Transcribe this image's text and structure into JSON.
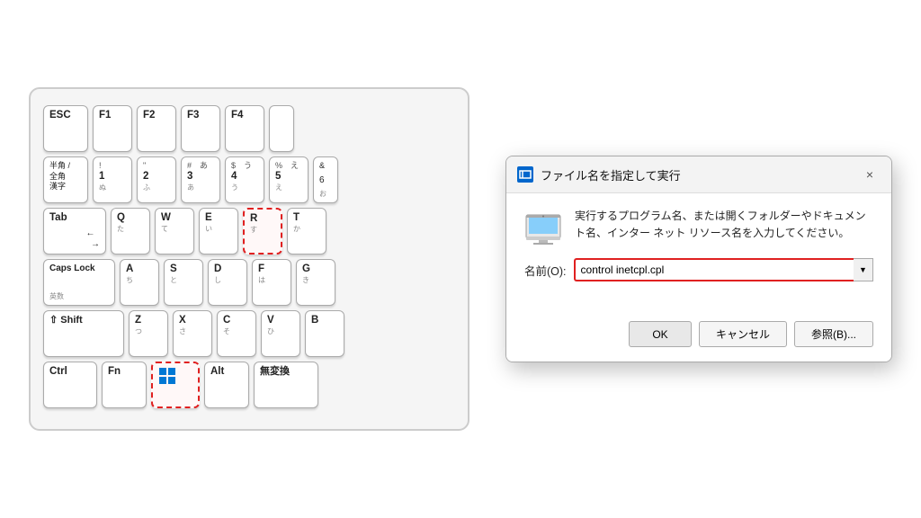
{
  "keyboard": {
    "rows": [
      {
        "id": "row0",
        "keys": [
          {
            "id": "esc",
            "label": "ESC",
            "sub": "",
            "jp": "",
            "wide": "esc",
            "highlighted": false
          },
          {
            "id": "f1",
            "label": "F1",
            "sub": "",
            "jp": "",
            "wide": "",
            "highlighted": false
          },
          {
            "id": "f2",
            "label": "F2",
            "sub": "",
            "jp": "",
            "wide": "",
            "highlighted": false
          },
          {
            "id": "f3",
            "label": "F3",
            "sub": "",
            "jp": "",
            "wide": "",
            "highlighted": false
          },
          {
            "id": "f4",
            "label": "F4",
            "sub": "",
            "jp": "",
            "wide": "",
            "highlighted": false
          },
          {
            "id": "f5-half",
            "label": "",
            "sub": "",
            "jp": "",
            "wide": "half-visible",
            "highlighted": false
          }
        ]
      },
      {
        "id": "row1",
        "keys": [
          {
            "id": "hankaku",
            "label": "半角 /\n全角\n漢字",
            "sub": "",
            "jp": "",
            "wide": "",
            "highlighted": false
          },
          {
            "id": "1",
            "label": "!",
            "sub": "1",
            "jp": "ぬ",
            "wide": "",
            "highlighted": false
          },
          {
            "id": "2",
            "label": "\"",
            "sub": "2",
            "jp": "ふ",
            "wide": "",
            "highlighted": false
          },
          {
            "id": "3",
            "label": "#",
            "sub": "3",
            "jp": "あ",
            "wide": "",
            "highlighted": false
          },
          {
            "id": "4",
            "label": "$",
            "sub": "4",
            "jp": "う",
            "wide": "",
            "highlighted": false
          },
          {
            "id": "5",
            "label": "%",
            "sub": "5",
            "jp": "え",
            "wide": "",
            "highlighted": false
          },
          {
            "id": "6",
            "label": "&",
            "sub": "6",
            "jp": "お",
            "wide": "half-visible",
            "highlighted": false
          }
        ]
      },
      {
        "id": "row2",
        "keys": [
          {
            "id": "tab",
            "label": "Tab",
            "sub": "←\n→",
            "jp": "",
            "wide": "tab-key",
            "highlighted": false
          },
          {
            "id": "q",
            "label": "Q",
            "sub": "",
            "jp": "た",
            "wide": "",
            "highlighted": false
          },
          {
            "id": "w",
            "label": "W",
            "sub": "",
            "jp": "て",
            "wide": "",
            "highlighted": false
          },
          {
            "id": "e",
            "label": "E",
            "sub": "",
            "jp": "い",
            "wide": "",
            "highlighted": false
          },
          {
            "id": "r",
            "label": "R",
            "sub": "",
            "jp": "す",
            "wide": "",
            "highlighted": true
          },
          {
            "id": "t",
            "label": "T",
            "sub": "",
            "jp": "か",
            "wide": "",
            "highlighted": false
          }
        ]
      },
      {
        "id": "row3",
        "keys": [
          {
            "id": "capslock",
            "label": "Caps Lock",
            "sub": "英数",
            "jp": "",
            "wide": "capslock",
            "highlighted": false
          },
          {
            "id": "a",
            "label": "A",
            "sub": "",
            "jp": "ち",
            "wide": "",
            "highlighted": false
          },
          {
            "id": "s",
            "label": "S",
            "sub": "",
            "jp": "と",
            "wide": "",
            "highlighted": false
          },
          {
            "id": "d",
            "label": "D",
            "sub": "",
            "jp": "し",
            "wide": "",
            "highlighted": false
          },
          {
            "id": "f",
            "label": "F",
            "sub": "",
            "jp": "は",
            "wide": "",
            "highlighted": false
          },
          {
            "id": "g",
            "label": "G",
            "sub": "",
            "jp": "き",
            "wide": "",
            "highlighted": false
          }
        ]
      },
      {
        "id": "row4",
        "keys": [
          {
            "id": "shift",
            "label": "⇧ Shift",
            "sub": "",
            "jp": "",
            "wide": "shift-left",
            "highlighted": false
          },
          {
            "id": "z",
            "label": "Z",
            "sub": "",
            "jp": "つ",
            "wide": "",
            "highlighted": false
          },
          {
            "id": "x",
            "label": "X",
            "sub": "",
            "jp": "さ",
            "wide": "",
            "highlighted": false
          },
          {
            "id": "c",
            "label": "C",
            "sub": "",
            "jp": "そ",
            "wide": "",
            "highlighted": false
          },
          {
            "id": "v",
            "label": "V",
            "sub": "",
            "jp": "ひ",
            "wide": "",
            "highlighted": false
          },
          {
            "id": "b",
            "label": "B",
            "sub": "",
            "jp": "",
            "wide": "",
            "highlighted": false
          }
        ]
      },
      {
        "id": "row5",
        "keys": [
          {
            "id": "ctrl",
            "label": "Ctrl",
            "sub": "",
            "jp": "",
            "wide": "ctrl",
            "highlighted": false
          },
          {
            "id": "fn",
            "label": "Fn",
            "sub": "",
            "jp": "",
            "wide": "fn",
            "highlighted": false
          },
          {
            "id": "win",
            "label": "WIN",
            "sub": "",
            "jp": "",
            "wide": "win-key",
            "highlighted": true,
            "isWin": true
          },
          {
            "id": "alt",
            "label": "Alt",
            "sub": "",
            "jp": "",
            "wide": "alt",
            "highlighted": false
          },
          {
            "id": "muhenkan",
            "label": "無変換",
            "sub": "",
            "jp": "",
            "wide": "muhenkan",
            "highlighted": false
          }
        ]
      }
    ]
  },
  "dialog": {
    "title": "ファイル名を指定して実行",
    "close_label": "×",
    "description": "実行するプログラム名、または開くフォルダーやドキュメント名、インター\nネット リソース名を入力してください。",
    "input_label": "名前(O):",
    "input_value": "control inetcpl.cpl",
    "dropdown_arrow": "▼",
    "ok_label": "OK",
    "cancel_label": "キャンセル",
    "browse_label": "参照(B)..."
  }
}
